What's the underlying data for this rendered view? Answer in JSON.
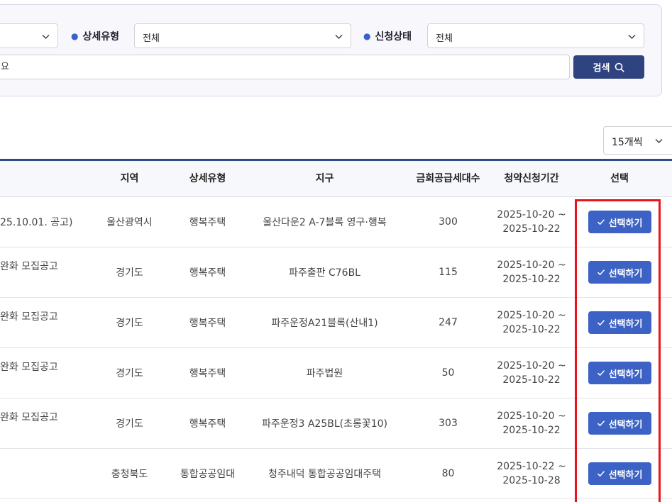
{
  "filters": {
    "detail_type_label": "상세유형",
    "detail_type_value": "전체",
    "status_label": "신청상태",
    "status_value": "전체",
    "search_placeholder_fragment": "요",
    "search_button_label": "검색"
  },
  "page_size": {
    "value": "15개씩"
  },
  "table": {
    "columns": [
      "지역",
      "상세유형",
      "지구",
      "금회공급세대수",
      "청약신청기간",
      "선택"
    ],
    "rows": [
      {
        "title": "25.10.01. 공고)",
        "region": "울산광역시",
        "type": "행복주택",
        "district": "울산다운2 A-7블록 영구·행복",
        "units": "300",
        "period_start": "2025-10-20 ~",
        "period_end": "2025-10-22",
        "action": "선택하기"
      },
      {
        "title": "완화 모집공고",
        "region": "경기도",
        "type": "행복주택",
        "district": "파주출판 C76BL",
        "units": "115",
        "period_start": "2025-10-20 ~",
        "period_end": "2025-10-22",
        "action": "선택하기"
      },
      {
        "title": "완화 모집공고",
        "region": "경기도",
        "type": "행복주택",
        "district": "파주운정A21블록(산내1)",
        "units": "247",
        "period_start": "2025-10-20 ~",
        "period_end": "2025-10-22",
        "action": "선택하기"
      },
      {
        "title": "완화 모집공고",
        "region": "경기도",
        "type": "행복주택",
        "district": "파주법원",
        "units": "50",
        "period_start": "2025-10-20 ~",
        "period_end": "2025-10-22",
        "action": "선택하기"
      },
      {
        "title": "완화 모집공고",
        "region": "경기도",
        "type": "행복주택",
        "district": "파주운정3 A25BL(초롱꽃10)",
        "units": "303",
        "period_start": "2025-10-20 ~",
        "period_end": "2025-10-22",
        "action": "선택하기"
      },
      {
        "title": "",
        "region": "충청북도",
        "type": "통합공공임대",
        "district": "청주내덕 통합공공임대주택",
        "units": "80",
        "period_start": "2025-10-22 ~",
        "period_end": "2025-10-28",
        "action": "선택하기"
      }
    ]
  },
  "colors": {
    "accent": "#3b62c4",
    "search_button": "#2f4380",
    "header_rule": "#2f4a8a",
    "highlight": "#e8141c"
  },
  "icons": {
    "chevron": "chevron-down-icon",
    "search": "search-icon",
    "check": "check-icon"
  }
}
